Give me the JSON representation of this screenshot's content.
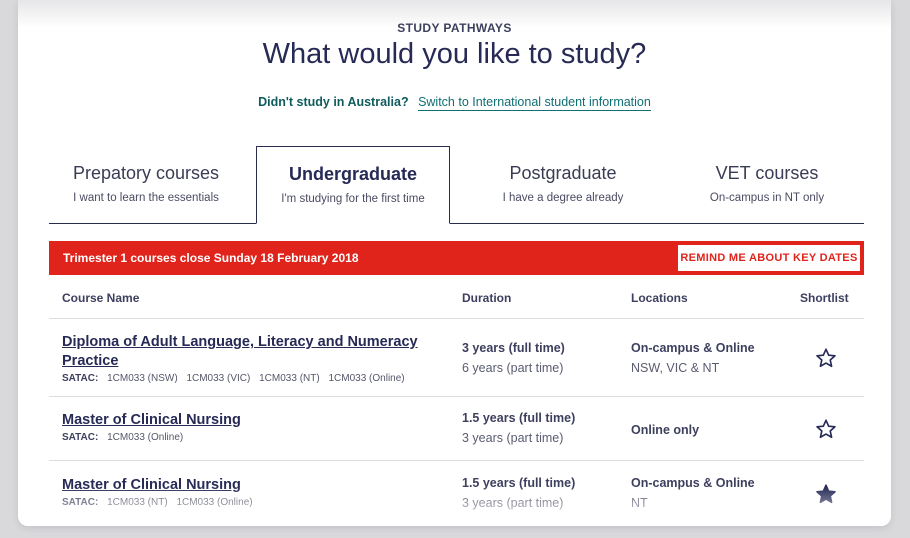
{
  "header": {
    "eyebrow": "STUDY PATHWAYS",
    "headline": "What would you like to study?",
    "intl_question": "Didn't study in Australia?",
    "intl_link": "Switch to International student information"
  },
  "tabs": [
    {
      "label": "Prepatory courses",
      "sub": "I want to learn the essentials",
      "active": false
    },
    {
      "label": "Undergraduate",
      "sub": "I'm studying for the first time",
      "active": true
    },
    {
      "label": "Postgraduate",
      "sub": "I have a degree already",
      "active": false
    },
    {
      "label": "VET courses",
      "sub": "On-campus in NT only",
      "active": false
    }
  ],
  "banner": {
    "text": "Trimester 1 courses close Sunday 18 February 2018",
    "button": "REMIND ME ABOUT KEY DATES"
  },
  "table": {
    "headers": {
      "name": "Course Name",
      "duration": "Duration",
      "locations": "Locations",
      "shortlist": "Shortlist"
    },
    "rows": [
      {
        "name": "Diploma of Adult Language, Literacy and Numeracy Practice",
        "code_label": "SATAC:",
        "codes": [
          "1CM033 (NSW)",
          "1CM033 (VIC)",
          "1CM033 (NT)",
          "1CM033 (Online)"
        ],
        "duration_ft": "3 years (full time)",
        "duration_pt": "6 years (part time)",
        "location_main": "On-campus & Online",
        "location_sub": "NSW, VIC & NT",
        "shortlisted": false
      },
      {
        "name": "Master of Clinical Nursing",
        "code_label": "SATAC:",
        "codes": [
          "1CM033 (Online)"
        ],
        "duration_ft": "1.5 years (full time)",
        "duration_pt": "3 years (part time)",
        "location_main": "Online only",
        "location_sub": "",
        "shortlisted": false
      },
      {
        "name": "Master of Clinical Nursing",
        "code_label": "SATAC:",
        "codes": [
          "1CM033 (NT)",
          "1CM033 (Online)"
        ],
        "duration_ft": "1.5 years (full time)",
        "duration_pt": "3 years (part time)",
        "location_main": "On-campus & Online",
        "location_sub": "NT",
        "shortlisted": true
      }
    ]
  },
  "colors": {
    "navy": "#262a55",
    "teal": "#0f6f73",
    "banner_red": "#e0241c",
    "page_bg": "#d9d9dc"
  },
  "icons": {
    "star_empty": "star-outline-icon",
    "star_filled": "star-filled-icon"
  }
}
